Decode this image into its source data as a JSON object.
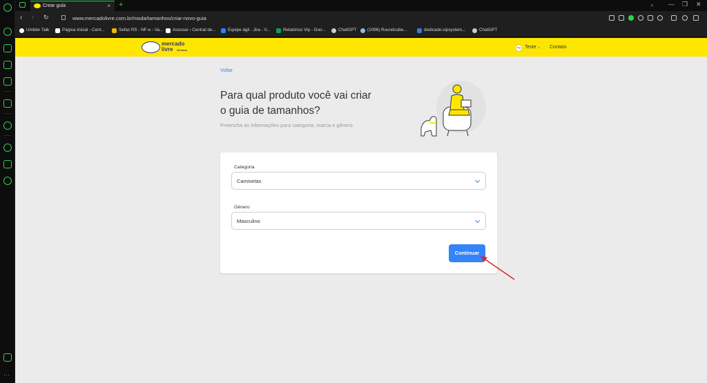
{
  "browser": {
    "tab_title": "Crear guía",
    "url": "www.mercadolivre.com.br/moda/tamanhos/criar-novo-guia",
    "bookmarks": [
      "Umbler Talk",
      "Página Inicial - Cent...",
      "Sefaz RS - NF-e - Va...",
      "Acessar › Central de...",
      "Equipe ágil - Jira - V...",
      "Relatórios Vip - Goo...",
      "ChatGPT",
      "(1096) Roundcube...",
      "dedicado.vipsystem...",
      "ChatGPT"
    ]
  },
  "header": {
    "logo_line1": "mercado",
    "logo_line2": "livre",
    "logo_badge": "25 anos",
    "avatar_initials": "TV",
    "user_name": "Teste",
    "contact": "Contato"
  },
  "main": {
    "back_link": "Voltar",
    "title": "Para qual produto você vai criar o guia de tamanhos?",
    "subtitle": "Preencha as informações para categoria, marca e gênero"
  },
  "form": {
    "category_label": "Categoria",
    "category_value": "Camisetas",
    "gender_label": "Gênero",
    "gender_value": "Masculino",
    "continue_label": "Continuar"
  },
  "colors": {
    "brand_yellow": "#ffe600",
    "accent_blue": "#3483fa",
    "browser_accent": "#2fd34f",
    "annotation_red": "#e0202a"
  }
}
